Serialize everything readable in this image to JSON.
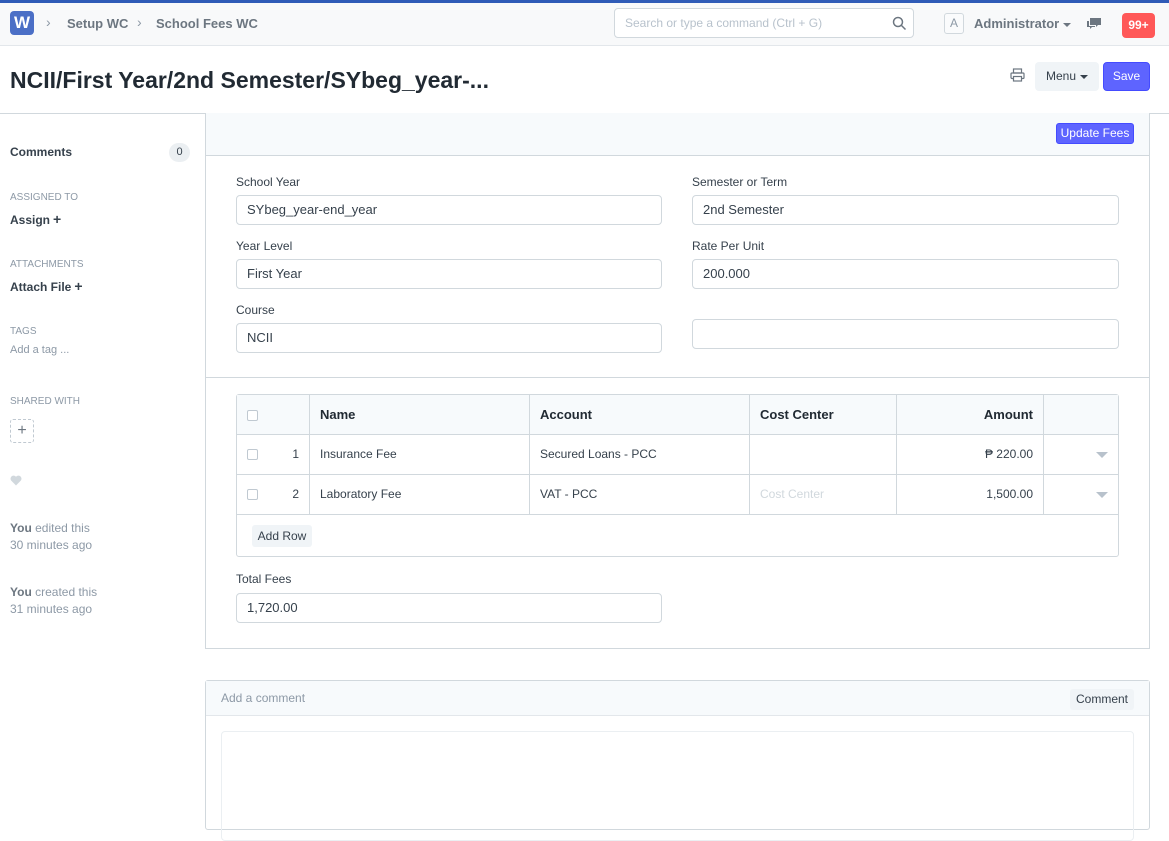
{
  "navbar": {
    "logo": "W",
    "breadcrumbs": [
      "Setup WC",
      "School Fees WC"
    ],
    "search_placeholder": "Search or type a command (Ctrl + G)",
    "avatar_letter": "A",
    "user_name": "Administrator",
    "notification_count": "99+"
  },
  "page": {
    "title": "NCII/First Year/2nd Semester/SYbeg_year-...",
    "menu_label": "Menu",
    "save_label": "Save"
  },
  "sidebar": {
    "comments_label": "Comments",
    "comments_count": "0",
    "assigned_to_label": "ASSIGNED TO",
    "assign_label": "Assign",
    "attachments_label": "ATTACHMENTS",
    "attach_label": "Attach File",
    "tags_label": "TAGS",
    "add_tag_label": "Add a tag ...",
    "shared_with_label": "SHARED WITH",
    "activity": [
      {
        "who": "You",
        "action": " edited this",
        "when": "30 minutes ago"
      },
      {
        "who": "You",
        "action": " created this",
        "when": "31 minutes ago"
      }
    ]
  },
  "form": {
    "update_fees_label": "Update Fees",
    "school_year_label": "School Year",
    "school_year_value": "SYbeg_year-end_year",
    "semester_label": "Semester or Term",
    "semester_value": "2nd Semester",
    "year_level_label": "Year Level",
    "year_level_value": "First Year",
    "rate_label": "Rate Per Unit",
    "rate_value": "200.000",
    "course_label": "Course",
    "course_value": "NCII",
    "extra_value": "",
    "total_fees_label": "Total Fees",
    "total_fees_value": "1,720.00"
  },
  "grid": {
    "columns": [
      "Name",
      "Account",
      "Cost Center",
      "Amount"
    ],
    "rows": [
      {
        "idx": "1",
        "name": "Insurance Fee",
        "account": "Secured Loans - PCC",
        "cost_center": "",
        "amount": "₱ 220.00"
      },
      {
        "idx": "2",
        "name": "Laboratory Fee",
        "account": "VAT - PCC",
        "cost_center": "Cost Center",
        "amount": "1,500.00"
      }
    ],
    "add_row_label": "Add Row"
  },
  "comment": {
    "placeholder": "Add a comment",
    "button_label": "Comment"
  }
}
